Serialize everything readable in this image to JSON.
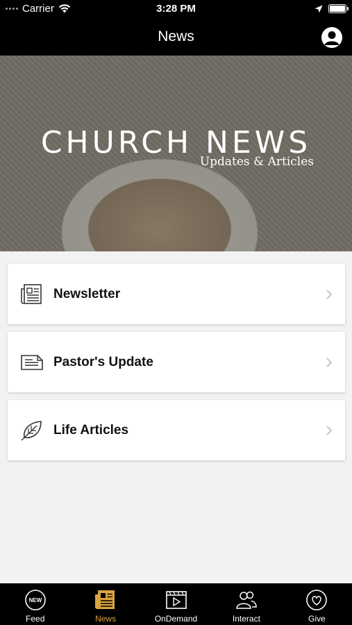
{
  "status_bar": {
    "carrier": "Carrier",
    "time": "3:28 PM"
  },
  "nav": {
    "title": "News"
  },
  "hero": {
    "title": "CHURCH NEWS",
    "subtitle": "Updates & Articles"
  },
  "menu": [
    {
      "label": "Newsletter",
      "icon": "newspaper-icon"
    },
    {
      "label": "Pastor's Update",
      "icon": "document-icon"
    },
    {
      "label": "Life Articles",
      "icon": "leaf-icon"
    }
  ],
  "tabs": [
    {
      "label": "Feed",
      "icon": "new-badge-icon",
      "badge_text": "NEW",
      "active": false
    },
    {
      "label": "News",
      "icon": "newspaper-icon",
      "active": true
    },
    {
      "label": "OnDemand",
      "icon": "video-icon",
      "active": false
    },
    {
      "label": "Interact",
      "icon": "people-icon",
      "active": false
    },
    {
      "label": "Give",
      "icon": "heart-circle-icon",
      "active": false
    }
  ],
  "colors": {
    "active_tab": "#d9a441",
    "bar_background": "#000000",
    "page_background": "#f2f2f2"
  }
}
